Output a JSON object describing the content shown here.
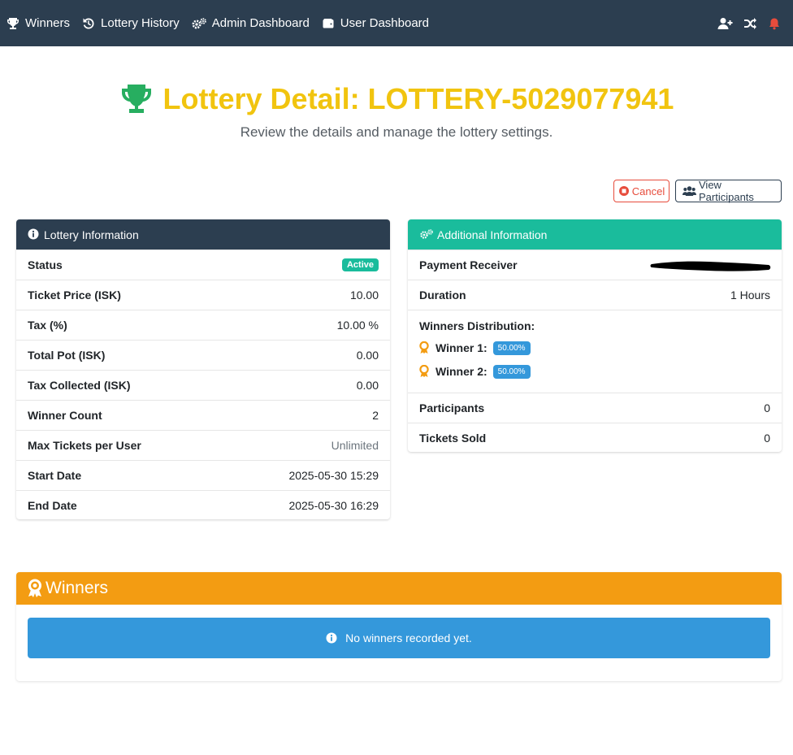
{
  "nav": {
    "items": [
      {
        "label": "Winners",
        "icon": "trophy-icon"
      },
      {
        "label": "Lottery History",
        "icon": "history-icon"
      },
      {
        "label": "Admin Dashboard",
        "icon": "cogs-icon"
      },
      {
        "label": "User Dashboard",
        "icon": "wallet-icon"
      }
    ],
    "right_icons": [
      "user-plus-icon",
      "shuffle-icon",
      "bell-icon"
    ]
  },
  "header": {
    "title": "Lottery Detail: LOTTERY-5029077941",
    "subtitle": "Review the details and manage the lottery settings."
  },
  "actions": {
    "cancel_label": "Cancel",
    "view_participants_label": "View Participants"
  },
  "lottery_info": {
    "title": "Lottery Information",
    "status_label": "Status",
    "status_value": "Active",
    "rows": [
      {
        "label": "Ticket Price (ISK)",
        "value": "10.00"
      },
      {
        "label": "Tax (%)",
        "value": "10.00 %"
      },
      {
        "label": "Total Pot (ISK)",
        "value": "0.00"
      },
      {
        "label": "Tax Collected (ISK)",
        "value": "0.00"
      },
      {
        "label": "Winner Count",
        "value": "2"
      },
      {
        "label": "Max Tickets per User",
        "value": "Unlimited"
      },
      {
        "label": "Start Date",
        "value": "2025-05-30 15:29"
      },
      {
        "label": "End Date",
        "value": "2025-05-30 16:29"
      }
    ]
  },
  "additional_info": {
    "title": "Additional Information",
    "payment_receiver_label": "Payment Receiver",
    "duration_label": "Duration",
    "duration_value": "1 Hours",
    "distribution_title": "Winners Distribution:",
    "winners": [
      {
        "label": "Winner 1:",
        "pct": "50.00%"
      },
      {
        "label": "Winner 2:",
        "pct": "50.00%"
      }
    ],
    "participants_label": "Participants",
    "participants_value": "0",
    "tickets_sold_label": "Tickets Sold",
    "tickets_sold_value": "0"
  },
  "winners_section": {
    "title": "Winners",
    "empty_message": "No winners recorded yet."
  },
  "colors": {
    "navbar": "#2c3e50",
    "title": "#f1c40f",
    "trophy": "#27ae60",
    "teal": "#1abc9c",
    "orange": "#f39c12",
    "blue": "#3498db",
    "red": "#e74c3c"
  }
}
